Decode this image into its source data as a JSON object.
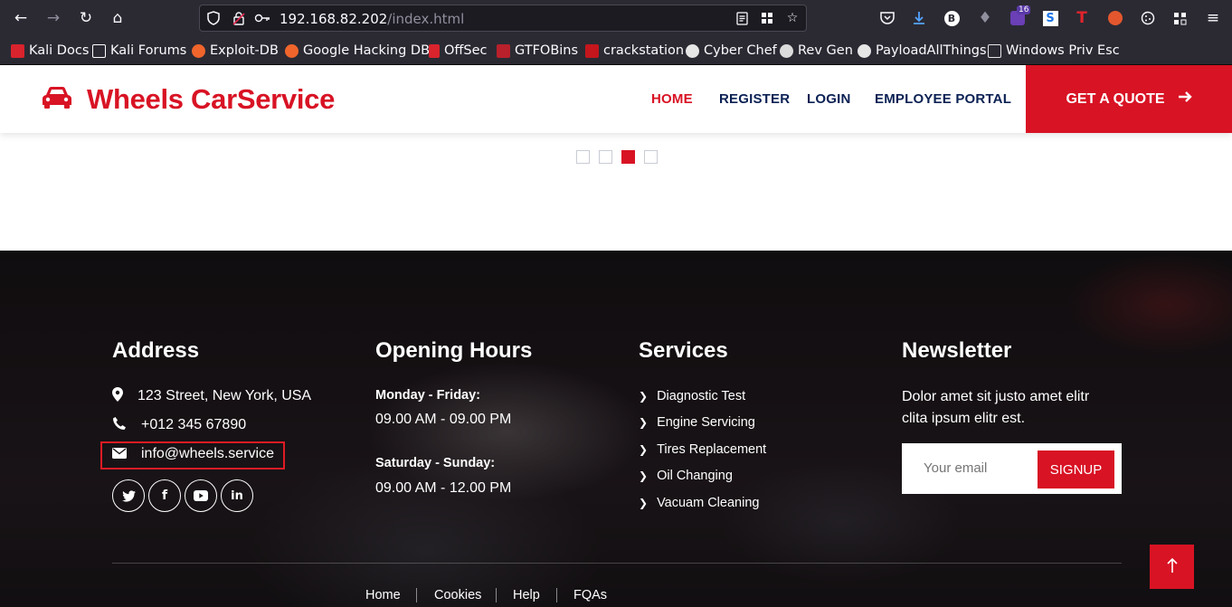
{
  "browser": {
    "url_host": "192.168.82.202",
    "url_path": "/index.html",
    "extension_badge": "16",
    "bookmarks": [
      {
        "label": "Kali Docs",
        "color": "#d9232d"
      },
      {
        "label": "Kali Forums",
        "color": "#ffffff"
      },
      {
        "label": "Exploit-DB",
        "color": "#f0652b"
      },
      {
        "label": "Google Hacking DB",
        "color": "#f0652b"
      },
      {
        "label": "OffSec",
        "color": "#d9232d"
      },
      {
        "label": "GTFOBins",
        "color": "#b8202b"
      },
      {
        "label": "crackstation",
        "color": "#c4161c"
      },
      {
        "label": "Cyber Chef",
        "color": "#e6e6e6"
      },
      {
        "label": "Rev Gen",
        "color": "#dcdcdc"
      },
      {
        "label": "PayloadAllThings",
        "color": "#e6e6e6"
      },
      {
        "label": "Windows Priv Esc",
        "color": "#e6e6e6"
      }
    ]
  },
  "header": {
    "brand": "Wheels CarService",
    "nav": [
      "HOME",
      "REGISTER",
      "LOGIN",
      "EMPLOYEE PORTAL"
    ],
    "cta": "GET A QUOTE",
    "accent": "#d81324",
    "nav_color": "#0b2154"
  },
  "carousel": {
    "slide_count": 4,
    "active_index": 2
  },
  "footer": {
    "address": {
      "title": "Address",
      "street": "123 Street, New York, USA",
      "phone": "+012 345 67890",
      "email": "info@wheels.service",
      "socials": [
        "twitter-icon",
        "facebook-icon",
        "youtube-icon",
        "linkedin-icon"
      ]
    },
    "hours": {
      "title": "Opening Hours",
      "weekday_label": "Monday - Friday:",
      "weekday_hours": "09.00 AM - 09.00 PM",
      "weekend_label": "Saturday - Sunday:",
      "weekend_hours": "09.00 AM - 12.00 PM"
    },
    "services": {
      "title": "Services",
      "items": [
        "Diagnostic Test",
        "Engine Servicing",
        "Tires Replacement",
        "Oil Changing",
        "Vacuam Cleaning"
      ]
    },
    "newsletter": {
      "title": "Newsletter",
      "text": "Dolor amet sit justo amet elitr clita ipsum elitr est.",
      "placeholder": "Your email",
      "button": "SIGNUP"
    },
    "links": [
      "Home",
      "Cookies",
      "Help",
      "FQAs"
    ]
  }
}
